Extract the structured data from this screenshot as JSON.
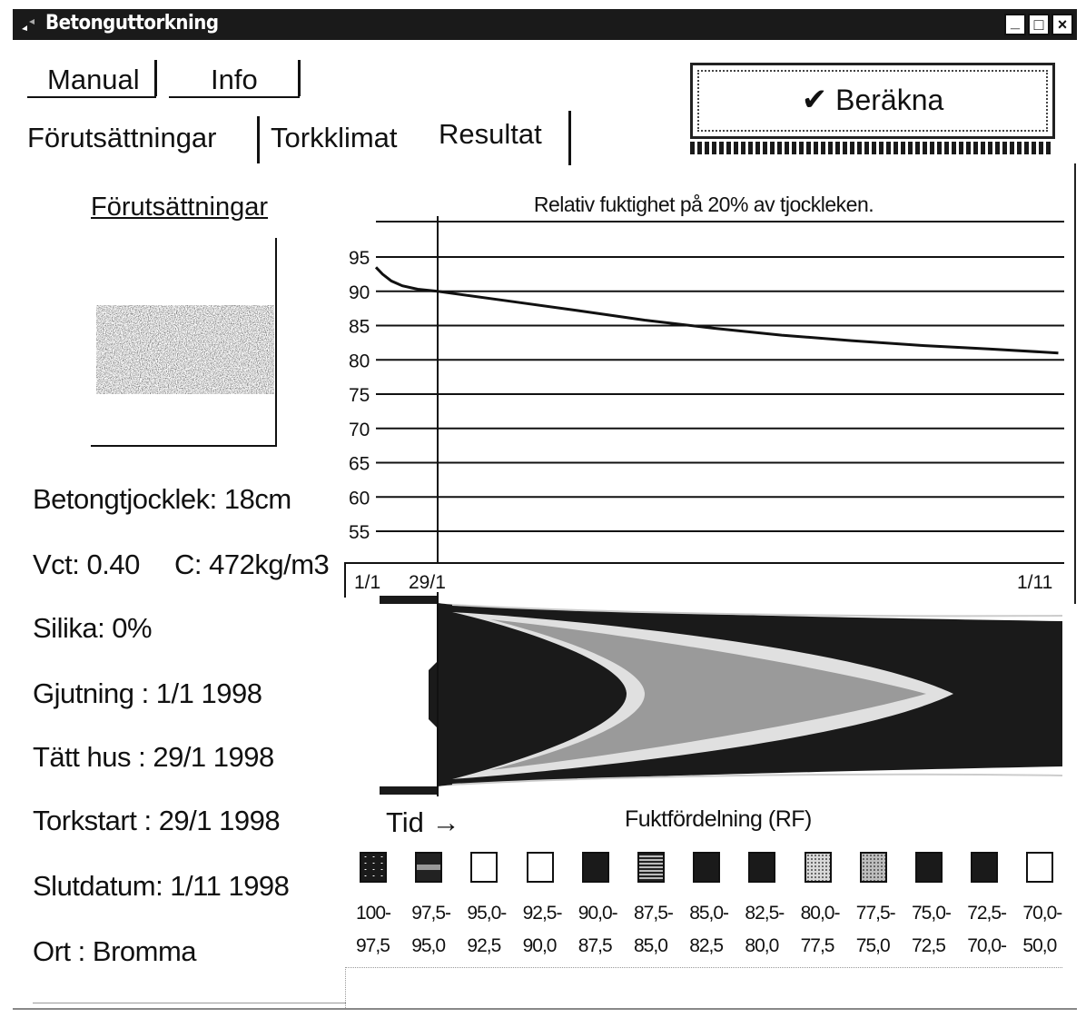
{
  "window": {
    "title": "Betonguttorkning",
    "minimize": "_",
    "maximize": "□",
    "close": "×"
  },
  "menu": {
    "manual": "Manual",
    "info": "Info"
  },
  "tabs": [
    "Förutsättningar",
    "Torkklimat",
    "Resultat"
  ],
  "compute": {
    "label": "Beräkna",
    "check": "✔"
  },
  "left_panel": {
    "section_title": "Förutsättningar",
    "thickness": "Betongtjocklek: 18cm",
    "vct": "Vct: 0.40",
    "cement": "C: 472kg/m3",
    "silika": "Silika: 0%",
    "gjutning": "Gjutning  : 1/1 1998",
    "tatt_hus": "Tätt hus  : 29/1 1998",
    "torkstart": "Torkstart : 29/1 1998",
    "slutdatum": "Slutdatum: 1/11 1998",
    "ort": "Ort     : Bromma"
  },
  "chart_data": {
    "type": "line",
    "title": "Relativ fuktighet på 20% av tjockleken.",
    "y_ticks": [
      95,
      90,
      85,
      80,
      75,
      70,
      65,
      60,
      55
    ],
    "ylim": [
      50,
      97
    ],
    "x_ticks": [
      "1/1",
      "29/1",
      "1/11"
    ],
    "grid": true,
    "series": [
      {
        "x": [
          "1/1",
          "4/1",
          "8/1",
          "13/1",
          "20/1",
          "29/1",
          "1/3",
          "1/4",
          "1/5",
          "1/6",
          "1/7",
          "1/8",
          "1/9",
          "1/10",
          "1/11"
        ],
        "values": [
          93.5,
          92.5,
          91.5,
          90.8,
          90.3,
          90.0,
          88.6,
          87.2,
          85.8,
          84.6,
          83.6,
          82.8,
          82.1,
          81.6,
          81.0
        ]
      }
    ]
  },
  "distribution": {
    "time_label": "Tid →",
    "title": "Fuktfördelning (RF)",
    "legend": [
      {
        "l1": "100-",
        "l2": "97,5",
        "fill": "#1a1a1a",
        "pattern": "speck"
      },
      {
        "l1": "97,5-",
        "l2": "95,0",
        "fill": "#222222",
        "pattern": "band"
      },
      {
        "l1": "95,0-",
        "l2": "92,5",
        "fill": "#ffffff",
        "pattern": "none"
      },
      {
        "l1": "92,5-",
        "l2": "90,0",
        "fill": "#ffffff",
        "pattern": "none"
      },
      {
        "l1": "90,0-",
        "l2": "87,5",
        "fill": "#1a1a1a",
        "pattern": "none"
      },
      {
        "l1": "87,5-",
        "l2": "85,0",
        "fill": "#2a2a2a",
        "pattern": "lines"
      },
      {
        "l1": "85,0-",
        "l2": "82,5",
        "fill": "#1a1a1a",
        "pattern": "none"
      },
      {
        "l1": "82,5-",
        "l2": "80,0",
        "fill": "#1a1a1a",
        "pattern": "none"
      },
      {
        "l1": "80,0-",
        "l2": "77,5",
        "fill": "#d8d8d8",
        "pattern": "dots"
      },
      {
        "l1": "77,5-",
        "l2": "75,0",
        "fill": "#bdbdbd",
        "pattern": "dots"
      },
      {
        "l1": "75,0-",
        "l2": "72,5",
        "fill": "#1a1a1a",
        "pattern": "none"
      },
      {
        "l1": "72,5-",
        "l2": "70,0-",
        "fill": "#1a1a1a",
        "pattern": "none"
      },
      {
        "l1": "70,0-",
        "l2": "50,0",
        "fill": "#ffffff",
        "pattern": "none"
      }
    ]
  },
  "colors": {
    "titlebar": "#1a1a1a",
    "ink": "#111111",
    "background": "#ffffff"
  }
}
